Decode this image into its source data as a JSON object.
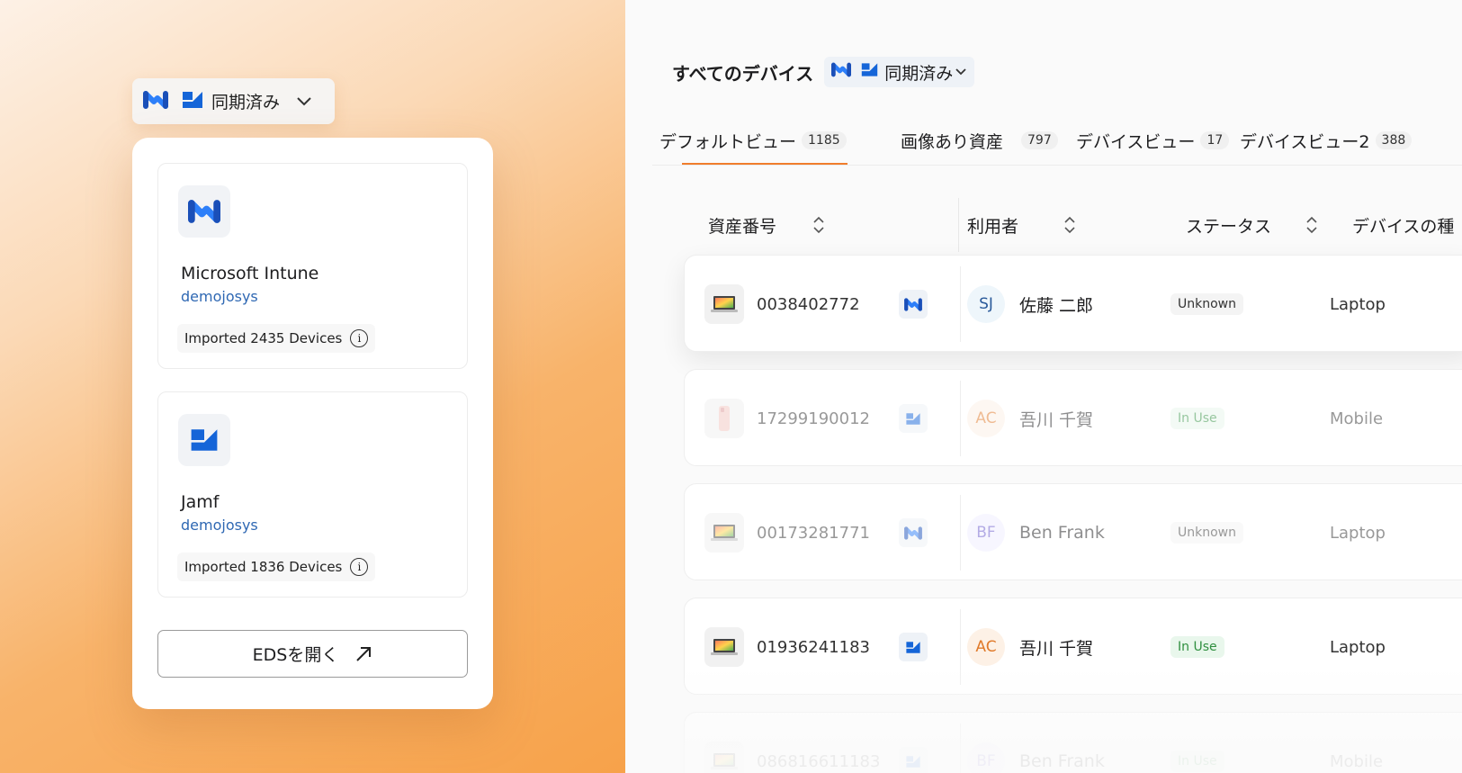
{
  "left": {
    "sync_chip": {
      "label": "同期済み"
    },
    "sources": [
      {
        "name": "Microsoft Intune",
        "account": "demojosys",
        "imported": "Imported 2435 Devices",
        "icon": "intune-icon"
      },
      {
        "name": "Jamf",
        "account": "demojosys",
        "imported": "Imported 1836 Devices",
        "icon": "jamf-icon"
      }
    ],
    "open_button": {
      "label": "EDSを開く"
    }
  },
  "right": {
    "title": "すべてのデバイス",
    "sync_label": "同期済み",
    "tabs": [
      {
        "label": "デフォルトビュー",
        "count": "1185"
      },
      {
        "label": "画像あり資産",
        "count": "797"
      },
      {
        "label": "デバイスビュー",
        "count": "17"
      },
      {
        "label": "デバイスビュー2",
        "count": "388"
      }
    ],
    "columns": {
      "asset_no": "資産番号",
      "user": "利用者",
      "status": "ステータス",
      "device_type": "デバイスの種"
    },
    "rows": [
      {
        "asset_no": "0038402772",
        "mdm": "intune",
        "initials": "SJ",
        "user": "佐藤 二郎",
        "status": "Unknown",
        "device_type": "Laptop"
      },
      {
        "asset_no": "17299190012",
        "mdm": "jamf",
        "initials": "AC",
        "user": "吾川 千賀",
        "status": "In Use",
        "device_type": "Mobile"
      },
      {
        "asset_no": "00173281771",
        "mdm": "intune",
        "initials": "BF",
        "user": "Ben Frank",
        "status": "Unknown",
        "device_type": "Laptop"
      },
      {
        "asset_no": "01936241183",
        "mdm": "jamf",
        "initials": "AC",
        "user": "吾川 千賀",
        "status": "In Use",
        "device_type": "Laptop"
      },
      {
        "asset_no": "086816611183",
        "mdm": "jamf",
        "initials": "BF",
        "user": "Ben Frank",
        "status": "In Use",
        "device_type": "Mobile"
      }
    ]
  },
  "colors": {
    "accent": "#f07d2c",
    "intune_blue": "#1a73e8",
    "jamf_blue": "#1565d8",
    "link_blue": "#2f68b3",
    "in_use_green": "#2f8f3f"
  }
}
